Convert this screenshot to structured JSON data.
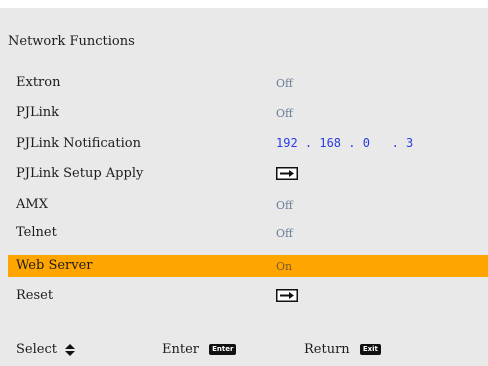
{
  "menu": {
    "title": "Network Functions",
    "rows": [
      {
        "label": "Extron",
        "value": "Off"
      },
      {
        "label": "PJLink",
        "value": "Off"
      },
      {
        "label": "PJLink Notification",
        "value": "192 . 168 . 0   . 3"
      },
      {
        "label": "PJLink Setup Apply",
        "value": ""
      },
      {
        "label": "AMX",
        "value": "Off"
      },
      {
        "label": "Telnet",
        "value": "Off"
      },
      {
        "label": "Web Server",
        "value": "On"
      },
      {
        "label": "Reset",
        "value": ""
      }
    ],
    "selected_row": "Web Server"
  },
  "footer": {
    "select_label": "Select",
    "enter_label": "Enter",
    "enter_key": "Enter",
    "return_label": "Return",
    "exit_key": "Exit"
  },
  "colors": {
    "background": "#e9e9e9",
    "highlight": "#ffa500",
    "value_text": "#6a7d9a",
    "ip_text": "#2a3ce6"
  }
}
